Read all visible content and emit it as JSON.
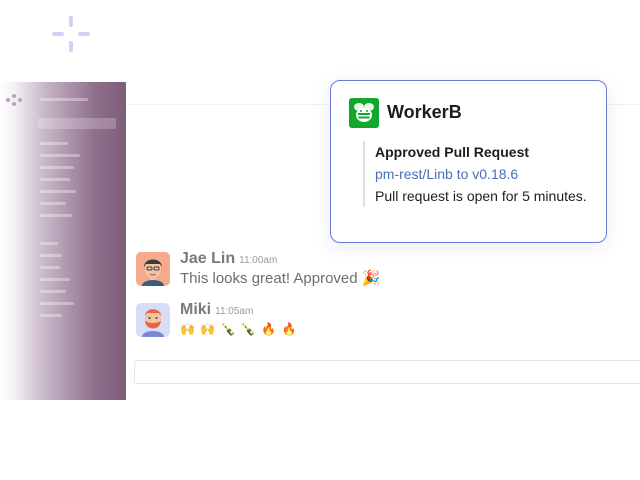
{
  "bot": {
    "name": "WorkerB",
    "logo_icon": "bee-icon",
    "logo_color": "#12a82e"
  },
  "notification": {
    "title": "Approved Pull Request",
    "link": "pm-rest/Linb to v0.18.6",
    "description": "Pull request is open for 5 minutes."
  },
  "messages": [
    {
      "author": "Jae Lin",
      "time": "11:00am",
      "text": "This looks great! Approved",
      "emoji": "🎉"
    },
    {
      "author": "Miki",
      "time": "11:05am",
      "emoji_row": [
        "🙌",
        "🙌",
        "🍾",
        "🍾",
        "🔥",
        "🔥"
      ]
    }
  ],
  "colors": {
    "accent_border": "#6f79d6",
    "link": "#4a6fb8",
    "sidebar": "#7c5e79"
  }
}
